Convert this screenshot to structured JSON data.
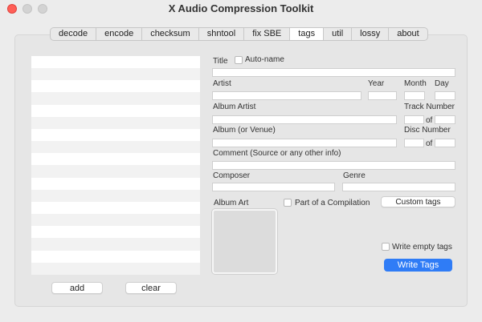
{
  "window": {
    "title": "X Audio Compression Toolkit"
  },
  "tabs": [
    {
      "label": "decode"
    },
    {
      "label": "encode"
    },
    {
      "label": "checksum"
    },
    {
      "label": "shntool"
    },
    {
      "label": "fix SBE"
    },
    {
      "label": "tags"
    },
    {
      "label": "util"
    },
    {
      "label": "lossy"
    },
    {
      "label": "about"
    }
  ],
  "active_tab": "tags",
  "file_list": {
    "row_count": 18
  },
  "buttons": {
    "add": "add",
    "clear": "clear",
    "custom_tags": "Custom tags",
    "write_tags": "Write Tags"
  },
  "form": {
    "title": "Title",
    "auto_name": "Auto-name",
    "artist": "Artist",
    "year": "Year",
    "month": "Month",
    "day": "Day",
    "album_artist": "Album Artist",
    "track_number": "Track Number",
    "of": "of",
    "album": "Album (or Venue)",
    "disc_number": "Disc Number",
    "comment": "Comment (Source or any other info)",
    "composer": "Composer",
    "genre": "Genre",
    "album_art": "Album Art",
    "part_of_compilation": "Part of a Compilation",
    "write_empty_tags": "Write empty tags"
  },
  "colors": {
    "accent": "#2f7cf6",
    "close": "#ff5f57"
  }
}
